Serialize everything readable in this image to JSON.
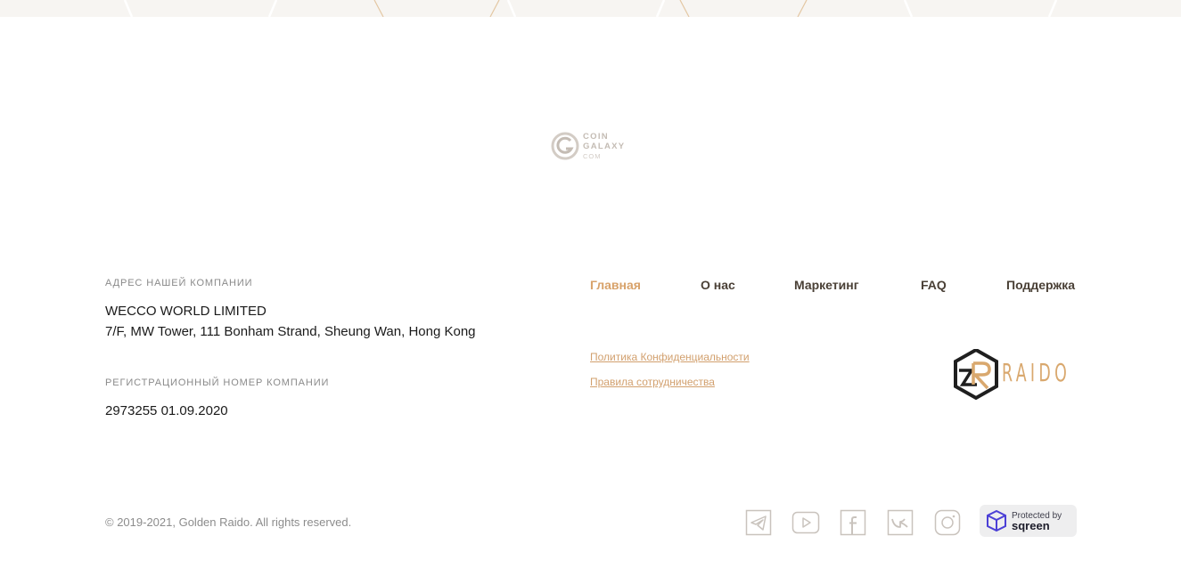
{
  "partner_logo": {
    "line1": "COIN",
    "line2": "GALAXY",
    "line3": "COM"
  },
  "company": {
    "address_caption": "АДРЕС НАШЕЙ КОМПАНИИ",
    "name": "WECCO WORLD LIMITED",
    "address": "7/F, MW Tower, 111 Bonham Strand, Sheung Wan, Hong Kong",
    "reg_caption": "РЕГИСТРАЦИОННЫЙ НОМЕР КОМПАНИИ",
    "reg_number": "2973255 01.09.2020"
  },
  "nav": {
    "items": [
      {
        "label": "Главная",
        "active": true
      },
      {
        "label": "О нас",
        "active": false
      },
      {
        "label": "Маркетинг",
        "active": false
      },
      {
        "label": "FAQ",
        "active": false
      },
      {
        "label": "Поддержка",
        "active": false
      }
    ]
  },
  "links": {
    "privacy": "Политика Конфиденциальности",
    "partnership": "Правила сотрудничества"
  },
  "brand": {
    "name": "RAIDO"
  },
  "footer": {
    "copyright": "© 2019-2021, Golden Raido. All rights reserved.",
    "social": [
      "telegram-icon",
      "youtube-icon",
      "facebook-icon",
      "vk-icon",
      "instagram-icon"
    ],
    "badge_top": "Protected by",
    "badge_bottom": "sqreen"
  },
  "colors": {
    "accent": "#d8a26a",
    "nav_text": "#4a4036",
    "icon_gray": "#c9c3bd",
    "raido_gold": "#d9a86e"
  }
}
